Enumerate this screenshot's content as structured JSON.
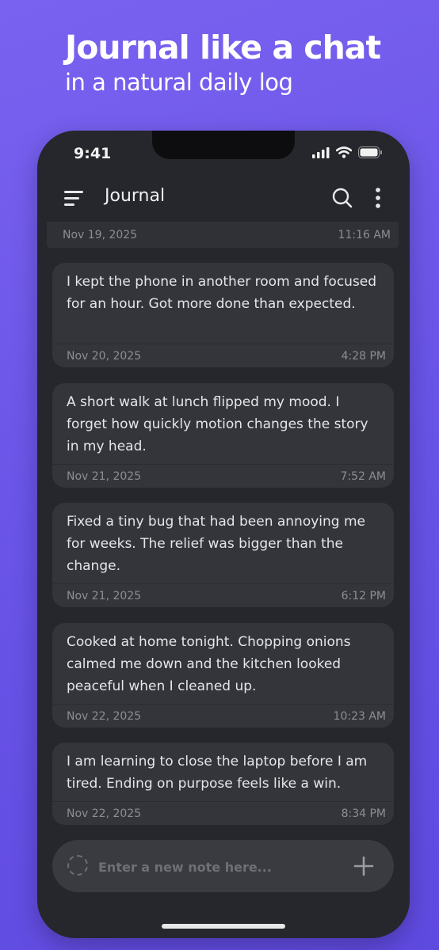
{
  "promo": {
    "title": "Journal like a chat",
    "subtitle": "in a natural daily log"
  },
  "status_bar": {
    "time": "9:41",
    "icons": [
      "cellular-signal-icon",
      "wifi-icon",
      "battery-icon"
    ]
  },
  "app_bar": {
    "title": "Journal",
    "icons": [
      "hamburger-menu-icon",
      "search-icon",
      "more-vertical-icon"
    ]
  },
  "entries": [
    {
      "text": "",
      "date": "Nov 19, 2025",
      "time": "11:16 AM"
    },
    {
      "text": "I kept the phone in another room and focused for an hour. Got more done than expected.",
      "date": "Nov 20, 2025",
      "time": "4:28 PM"
    },
    {
      "text": "A short walk at lunch flipped my mood. I forget how quickly motion changes the story in my head.",
      "date": "Nov 21, 2025",
      "time": "7:52 AM"
    },
    {
      "text": "Fixed a tiny bug that had been annoying me for weeks. The relief was bigger than the change.",
      "date": "Nov 21, 2025",
      "time": "6:12 PM"
    },
    {
      "text": "Cooked at home tonight. Chopping onions calmed me down and the kitchen looked peaceful when I cleaned up.",
      "date": "Nov 22, 2025",
      "time": "10:23 AM"
    },
    {
      "text": "I am learning to close the laptop before I am tired. Ending on purpose feels like a win.",
      "date": "Nov 22, 2025",
      "time": "8:34 PM"
    }
  ],
  "composer": {
    "placeholder": "Enter a new note here...",
    "value": "",
    "add_icon": "plus-icon",
    "mood_icon": "dashed-circle-icon"
  },
  "colors": {
    "background": "#6a55e8",
    "phone": "#25272c",
    "card": "#33353b",
    "composer": "#393b41"
  }
}
